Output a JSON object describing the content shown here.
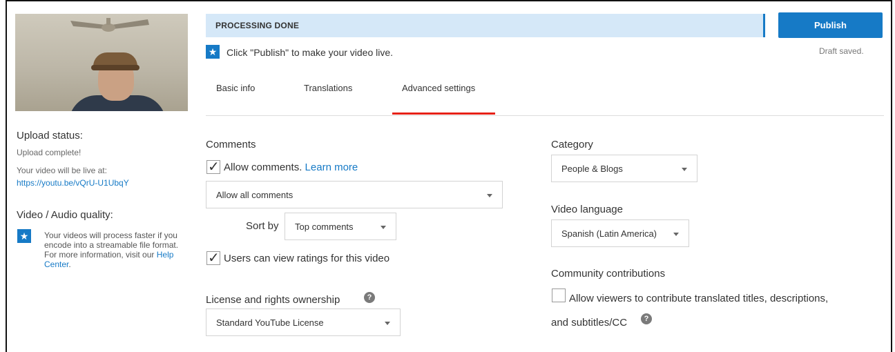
{
  "processing": {
    "status": "PROCESSING DONE"
  },
  "publish": {
    "label": "Publish",
    "draft": "Draft saved."
  },
  "hint": {
    "text": "Click \"Publish\" to make your video live."
  },
  "tabs": [
    {
      "label": "Basic info"
    },
    {
      "label": "Translations"
    },
    {
      "label": "Advanced settings"
    }
  ],
  "sidebar": {
    "upload_title": "Upload status:",
    "upload_complete": "Upload complete!",
    "live_at": "Your video will be live at:",
    "video_url": "https://youtu.be/vQrU-U1UbqY",
    "quality_title": "Video / Audio quality:",
    "quality_text": "Your videos will process faster if you encode into a streamable file format. For more information, visit our",
    "help_center": "Help Center",
    "period": "."
  },
  "comments": {
    "title": "Comments",
    "allow_label": "Allow comments.",
    "learn_more": "Learn more",
    "allow_select": "Allow all comments",
    "sort_label": "Sort by",
    "sort_select": "Top comments",
    "ratings_label": "Users can view ratings for this video"
  },
  "license": {
    "title": "License and rights ownership",
    "select": "Standard YouTube License"
  },
  "category": {
    "title": "Category",
    "select": "People & Blogs"
  },
  "language": {
    "title": "Video language",
    "select": "Spanish (Latin America)"
  },
  "community": {
    "title": "Community contributions",
    "line1": "Allow viewers to contribute translated titles, descriptions,",
    "line2": "and subtitles/CC"
  },
  "colors": {
    "accent": "#167ac6",
    "tab_active": "#e62117",
    "processing_bg": "#d5e8f8"
  }
}
